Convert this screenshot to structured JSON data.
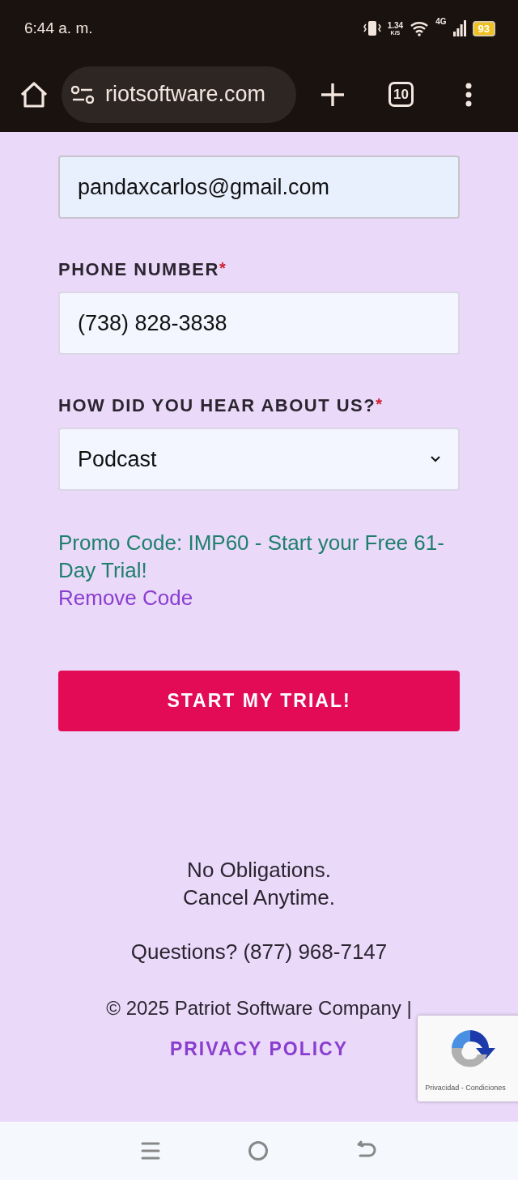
{
  "status_bar": {
    "time": "6:44 a. m.",
    "speed": "1.34",
    "speed_unit": "K/S",
    "network": "4G",
    "battery": "93"
  },
  "browser": {
    "url": "riotsoftware.com",
    "tab_count": "10"
  },
  "form": {
    "fields": [
      {
        "kind": "input",
        "value": "pandaxcarlos@gmail.com",
        "autofilled": true
      },
      {
        "kind": "input",
        "label": "PHONE NUMBER",
        "required_mark": "*",
        "value": "(738) 828-3838",
        "autofilled": false
      },
      {
        "kind": "select",
        "label": "HOW DID YOU HEAR ABOUT US?",
        "required_mark": "*",
        "value": "Podcast",
        "autofilled": false
      }
    ],
    "promo": "Promo Code: IMP60 - Start your Free 61-Day Trial!",
    "remove_link": "Remove Code",
    "submit": "START MY TRIAL!"
  },
  "footer": {
    "lines": [
      "No Obligations.",
      "Cancel Anytime."
    ],
    "questions": "Questions? (877) 968-7147",
    "copyright": "© 2025 Patriot Software Company |",
    "privacy": "PRIVACY POLICY"
  },
  "recaptcha": {
    "links": "Privacidad - Condiciones"
  }
}
